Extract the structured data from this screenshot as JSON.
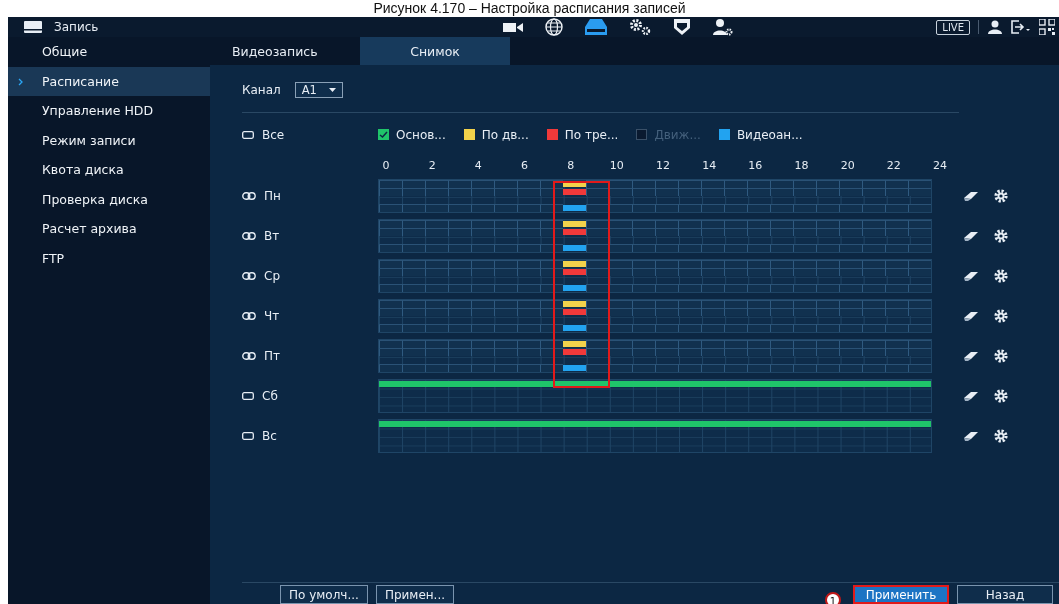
{
  "caption": "Рисунок 4.170 – Настройка расписания записей",
  "topbar": {
    "title": "Запись",
    "icons": [
      {
        "kind": "camera",
        "selected": false
      },
      {
        "kind": "globe",
        "selected": false
      },
      {
        "kind": "storage",
        "selected": true
      },
      {
        "kind": "gears",
        "selected": false
      },
      {
        "kind": "shield",
        "selected": false
      },
      {
        "kind": "user-gear",
        "selected": false
      }
    ],
    "live": "LIVE"
  },
  "sidebar": {
    "items": [
      {
        "label": "Общие",
        "selected": false
      },
      {
        "label": "Расписание",
        "selected": true
      },
      {
        "label": "Управление HDD",
        "selected": false
      },
      {
        "label": "Режим записи",
        "selected": false
      },
      {
        "label": "Квота диска",
        "selected": false
      },
      {
        "label": "Проверка диска",
        "selected": false
      },
      {
        "label": "Расчет архива",
        "selected": false
      },
      {
        "label": "FTP",
        "selected": false
      }
    ]
  },
  "tabs": [
    {
      "label": "Видеозапись",
      "selected": false
    },
    {
      "label": "Снимок",
      "selected": true
    }
  ],
  "channel": {
    "label": "Канал",
    "value": "A1"
  },
  "all_label": "Все",
  "legend": [
    {
      "label": "Основ...",
      "color": "#1fc56a",
      "checked": true,
      "disabled": false
    },
    {
      "label": "По дв...",
      "color": "#f2d24b",
      "checked": false,
      "disabled": false
    },
    {
      "label": "По тре...",
      "color": "#f0393a",
      "checked": false,
      "disabled": false
    },
    {
      "label": "Движ...",
      "color": "#0a1a30",
      "checked": false,
      "disabled": true
    },
    {
      "label": "Видеоан...",
      "color": "#22a3f0",
      "checked": false,
      "disabled": false
    }
  ],
  "hours": [
    "0",
    "2",
    "4",
    "6",
    "8",
    "10",
    "12",
    "14",
    "16",
    "18",
    "20",
    "22",
    "24"
  ],
  "days": [
    {
      "name": "Пн",
      "linked": true,
      "lanes": [
        {
          "kind": "top",
          "color": "#f2d24b",
          "slots": [
            false,
            false,
            false,
            false,
            false,
            false,
            false,
            false,
            true,
            false,
            false,
            false,
            false,
            false,
            false,
            false,
            false,
            false,
            false,
            false,
            false,
            false,
            false,
            false
          ]
        },
        {
          "kind": "middle",
          "color": "#f0393a",
          "slots": [
            false,
            false,
            false,
            false,
            false,
            false,
            false,
            false,
            true,
            false,
            false,
            false,
            false,
            false,
            false,
            false,
            false,
            false,
            false,
            false,
            false,
            false,
            false,
            false
          ]
        },
        {
          "kind": "bottom",
          "color": "#22a3f0",
          "slots": [
            false,
            false,
            false,
            false,
            false,
            false,
            false,
            false,
            true,
            false,
            false,
            false,
            false,
            false,
            false,
            false,
            false,
            false,
            false,
            false,
            false,
            false,
            false,
            false
          ]
        }
      ]
    },
    {
      "name": "Вт",
      "linked": true,
      "lanes": [
        {
          "kind": "top",
          "color": "#f2d24b",
          "slots": [
            false,
            false,
            false,
            false,
            false,
            false,
            false,
            false,
            true,
            false,
            false,
            false,
            false,
            false,
            false,
            false,
            false,
            false,
            false,
            false,
            false,
            false,
            false,
            false
          ]
        },
        {
          "kind": "middle",
          "color": "#f0393a",
          "slots": [
            false,
            false,
            false,
            false,
            false,
            false,
            false,
            false,
            true,
            false,
            false,
            false,
            false,
            false,
            false,
            false,
            false,
            false,
            false,
            false,
            false,
            false,
            false,
            false
          ]
        },
        {
          "kind": "bottom",
          "color": "#22a3f0",
          "slots": [
            false,
            false,
            false,
            false,
            false,
            false,
            false,
            false,
            true,
            false,
            false,
            false,
            false,
            false,
            false,
            false,
            false,
            false,
            false,
            false,
            false,
            false,
            false,
            false
          ]
        }
      ]
    },
    {
      "name": "Ср",
      "linked": true,
      "lanes": [
        {
          "kind": "top",
          "color": "#f2d24b",
          "slots": [
            false,
            false,
            false,
            false,
            false,
            false,
            false,
            false,
            true,
            false,
            false,
            false,
            false,
            false,
            false,
            false,
            false,
            false,
            false,
            false,
            false,
            false,
            false,
            false
          ]
        },
        {
          "kind": "middle",
          "color": "#f0393a",
          "slots": [
            false,
            false,
            false,
            false,
            false,
            false,
            false,
            false,
            true,
            false,
            false,
            false,
            false,
            false,
            false,
            false,
            false,
            false,
            false,
            false,
            false,
            false,
            false,
            false
          ]
        },
        {
          "kind": "bottom",
          "color": "#22a3f0",
          "slots": [
            false,
            false,
            false,
            false,
            false,
            false,
            false,
            false,
            true,
            false,
            false,
            false,
            false,
            false,
            false,
            false,
            false,
            false,
            false,
            false,
            false,
            false,
            false,
            false
          ]
        }
      ]
    },
    {
      "name": "Чт",
      "linked": true,
      "lanes": [
        {
          "kind": "top",
          "color": "#f2d24b",
          "slots": [
            false,
            false,
            false,
            false,
            false,
            false,
            false,
            false,
            true,
            false,
            false,
            false,
            false,
            false,
            false,
            false,
            false,
            false,
            false,
            false,
            false,
            false,
            false,
            false
          ]
        },
        {
          "kind": "middle",
          "color": "#f0393a",
          "slots": [
            false,
            false,
            false,
            false,
            false,
            false,
            false,
            false,
            true,
            false,
            false,
            false,
            false,
            false,
            false,
            false,
            false,
            false,
            false,
            false,
            false,
            false,
            false,
            false
          ]
        },
        {
          "kind": "bottom",
          "color": "#22a3f0",
          "slots": [
            false,
            false,
            false,
            false,
            false,
            false,
            false,
            false,
            true,
            false,
            false,
            false,
            false,
            false,
            false,
            false,
            false,
            false,
            false,
            false,
            false,
            false,
            false,
            false
          ]
        }
      ]
    },
    {
      "name": "Пт",
      "linked": true,
      "lanes": [
        {
          "kind": "top",
          "color": "#f2d24b",
          "slots": [
            false,
            false,
            false,
            false,
            false,
            false,
            false,
            false,
            true,
            false,
            false,
            false,
            false,
            false,
            false,
            false,
            false,
            false,
            false,
            false,
            false,
            false,
            false,
            false
          ]
        },
        {
          "kind": "middle",
          "color": "#f0393a",
          "slots": [
            false,
            false,
            false,
            false,
            false,
            false,
            false,
            false,
            true,
            false,
            false,
            false,
            false,
            false,
            false,
            false,
            false,
            false,
            false,
            false,
            false,
            false,
            false,
            false
          ]
        },
        {
          "kind": "bottom",
          "color": "#22a3f0",
          "slots": [
            false,
            false,
            false,
            false,
            false,
            false,
            false,
            false,
            true,
            false,
            false,
            false,
            false,
            false,
            false,
            false,
            false,
            false,
            false,
            false,
            false,
            false,
            false,
            false
          ]
        }
      ]
    },
    {
      "name": "Сб",
      "linked": false,
      "lanes": [
        {
          "kind": "top",
          "color": "#1fc56a",
          "slots": [
            true,
            true,
            true,
            true,
            true,
            true,
            true,
            true,
            true,
            true,
            true,
            true,
            true,
            true,
            true,
            true,
            true,
            true,
            true,
            true,
            true,
            true,
            true,
            true
          ]
        }
      ]
    },
    {
      "name": "Вс",
      "linked": false,
      "lanes": [
        {
          "kind": "top",
          "color": "#1fc56a",
          "slots": [
            true,
            true,
            true,
            true,
            true,
            true,
            true,
            true,
            true,
            true,
            true,
            true,
            true,
            true,
            true,
            true,
            true,
            true,
            true,
            true,
            true,
            true,
            true,
            true
          ]
        }
      ]
    }
  ],
  "footer": {
    "left_buttons": [
      "По умолч...",
      "Примен..."
    ],
    "right_buttons": [
      {
        "label": "Применить",
        "annotated": true,
        "badge": "1"
      },
      {
        "label": "Назад",
        "annotated": false
      }
    ]
  }
}
